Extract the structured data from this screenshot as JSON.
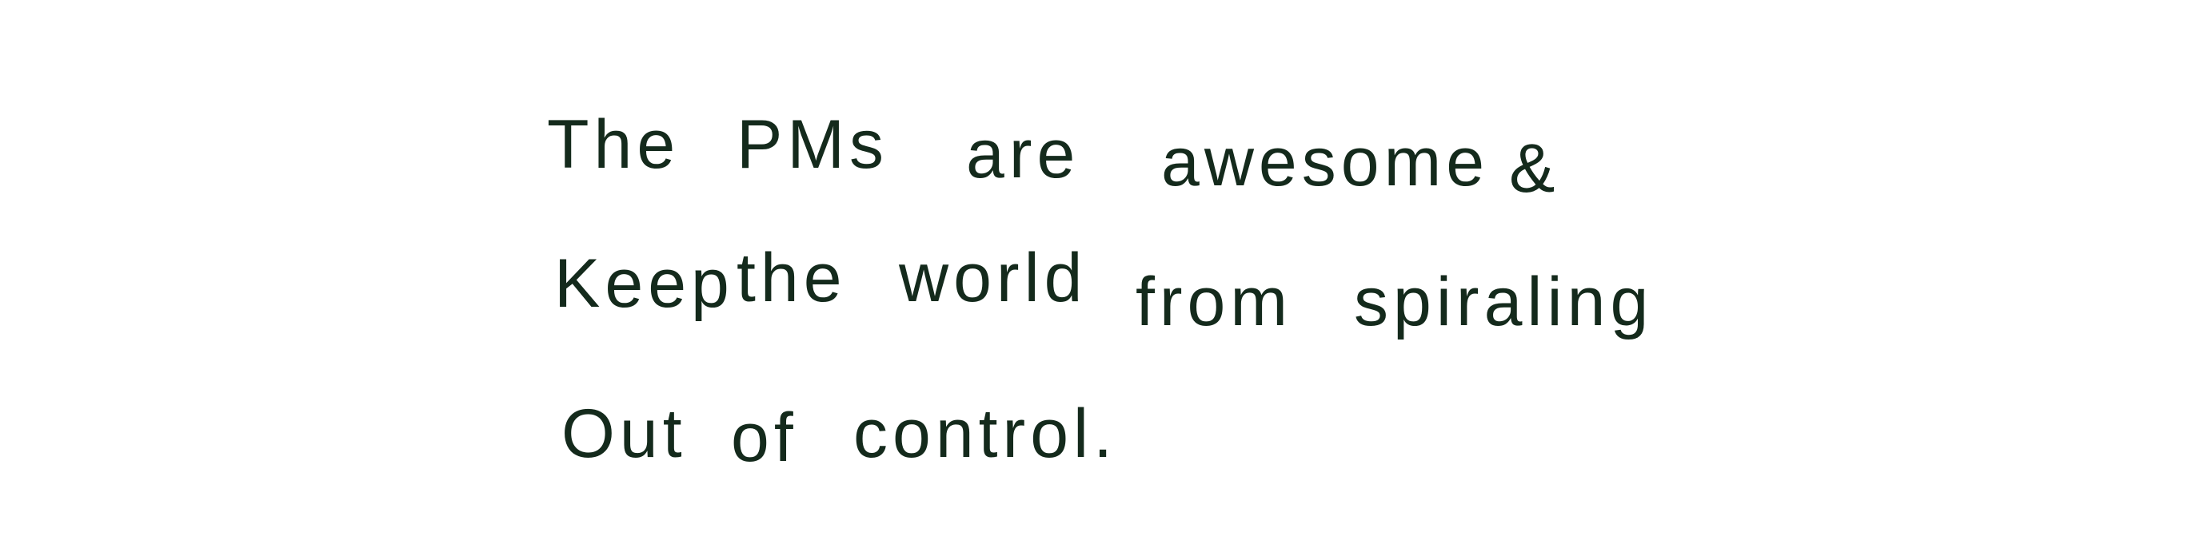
{
  "note": {
    "lines": [
      {
        "words": [
          "The",
          "PMs",
          "are",
          "awesome",
          "&"
        ]
      },
      {
        "words": [
          "Keep",
          "the",
          "world",
          "from",
          "spiraling"
        ]
      },
      {
        "words": [
          "Out",
          "of",
          "control."
        ]
      }
    ],
    "ink_color": "#142a1c",
    "paper_color": "#ffffff"
  }
}
